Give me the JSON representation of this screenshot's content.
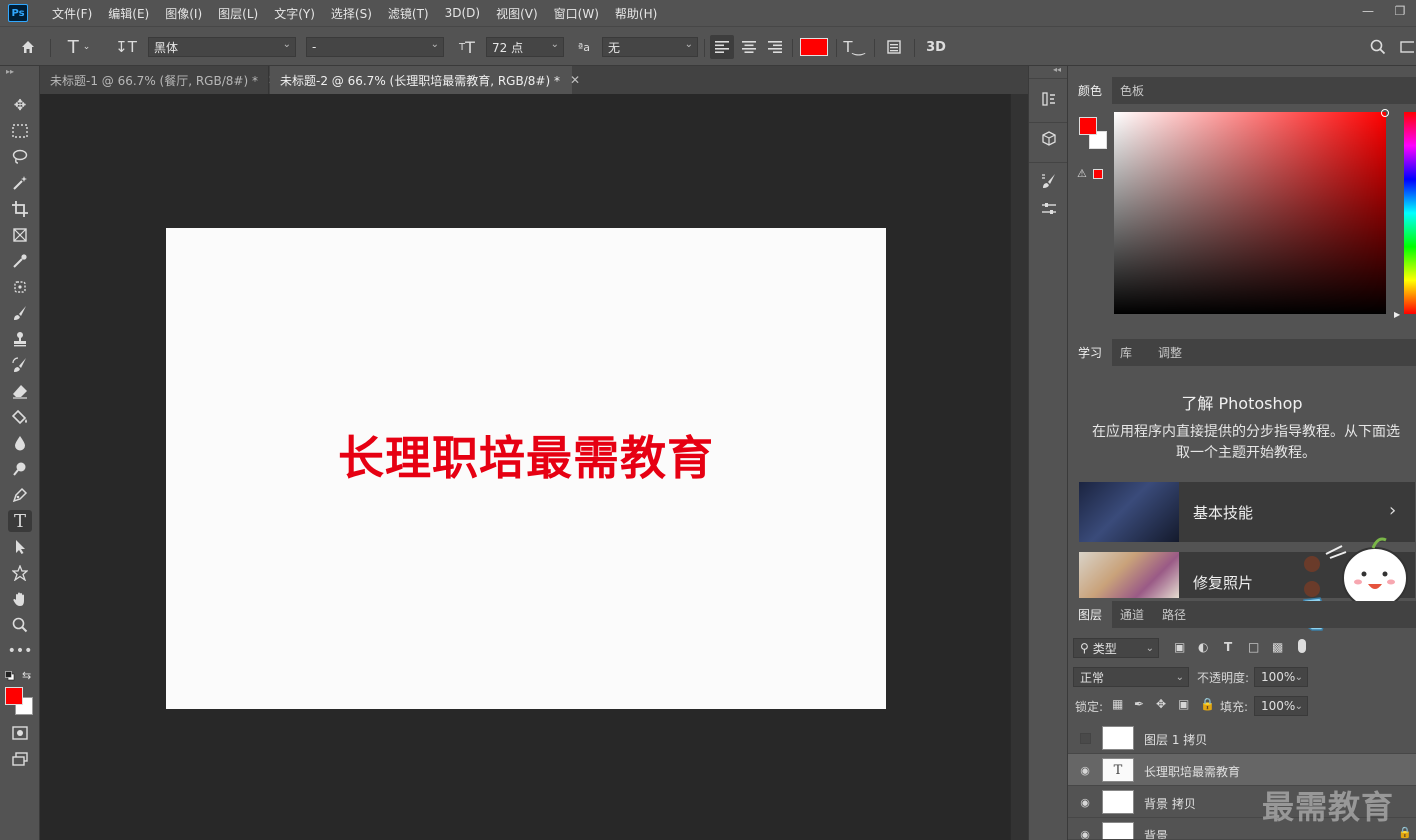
{
  "app": {
    "logo": "Ps"
  },
  "menu": [
    "文件(F)",
    "编辑(E)",
    "图像(I)",
    "图层(L)",
    "文字(Y)",
    "选择(S)",
    "滤镜(T)",
    "3D(D)",
    "视图(V)",
    "窗口(W)",
    "帮助(H)"
  ],
  "options": {
    "font_family": "黑体",
    "font_style": "-",
    "font_size": "72 点",
    "antialias": "无",
    "three_d_label": "3D",
    "text_color": "#ff0000"
  },
  "tabs": [
    {
      "label": "未标题-1 @ 66.7% (餐厅, RGB/8#) *",
      "active": false
    },
    {
      "label": "未标题-2 @ 66.7% (长理职培最需教育, RGB/8#) *",
      "active": true
    }
  ],
  "canvas": {
    "text": "长理职培最需教育",
    "text_color": "#e60012"
  },
  "color_panel": {
    "tabs": [
      "颜色",
      "色板"
    ],
    "foreground": "#ff0000",
    "background": "#ffffff"
  },
  "learn_panel": {
    "tabs": [
      "学习",
      "库",
      "调整"
    ],
    "title": "了解 Photoshop",
    "description": "在应用程序内直接提供的分步指导教程。从下面选取一个主题开始教程。",
    "cards": [
      "基本技能",
      "修复照片"
    ]
  },
  "layers_panel": {
    "tabs": [
      "图层",
      "通道",
      "路径"
    ],
    "filter_kind": "类型",
    "blend_mode": "正常",
    "opacity_label": "不透明度:",
    "opacity": "100%",
    "lock_label": "锁定:",
    "fill_label": "填充:",
    "fill": "100%",
    "layers": [
      {
        "name": "图层 1 拷贝",
        "visible": false,
        "type": "pixel"
      },
      {
        "name": "长理职培最需教育",
        "visible": true,
        "type": "text"
      },
      {
        "name": "背景 拷贝",
        "visible": true,
        "type": "pixel"
      },
      {
        "name": "背景",
        "visible": true,
        "type": "pixel"
      }
    ]
  },
  "watermark": "最需教育"
}
